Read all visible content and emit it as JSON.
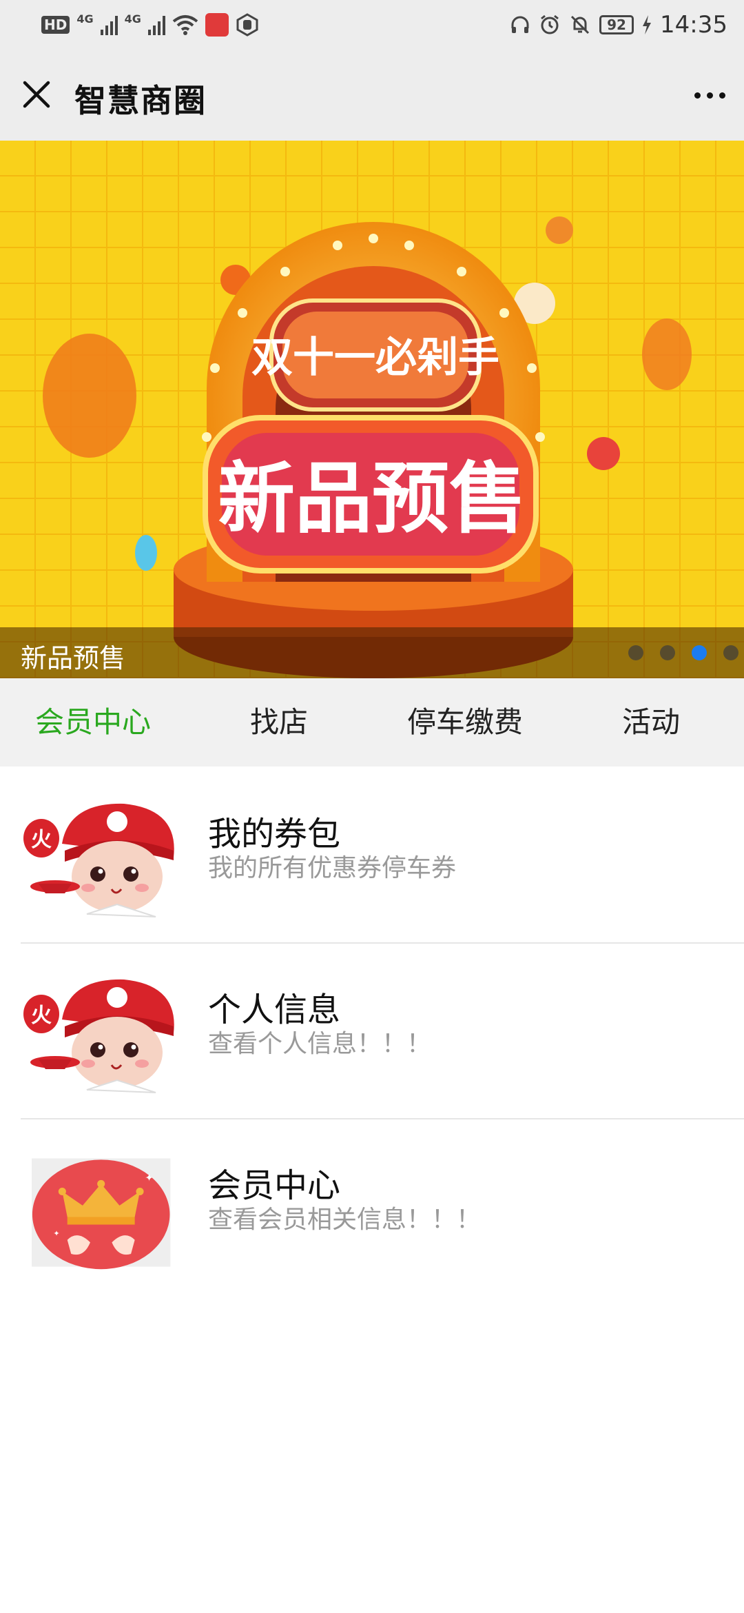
{
  "status_bar": {
    "left_label": "HD",
    "network_1": "4G",
    "network_2": "4G",
    "battery": "92",
    "time": "14:35"
  },
  "nav": {
    "title": "智慧商圈"
  },
  "banner": {
    "top_text": "双十一必剁手",
    "main_text": "新品预售",
    "caption": "新品预售",
    "slide_count": 4,
    "active_slide": 3
  },
  "tabs": [
    {
      "label": "会员中心",
      "active": true
    },
    {
      "label": "找店",
      "active": false
    },
    {
      "label": "停车缴费",
      "active": false
    },
    {
      "label": "活动",
      "active": false
    }
  ],
  "list": [
    {
      "title": "我的券包",
      "desc": "我的所有优惠券停车券",
      "icon": "chef-mascot-icon"
    },
    {
      "title": "个人信息",
      "desc": "查看个人信息！！！",
      "icon": "chef-mascot-icon"
    },
    {
      "title": "会员中心",
      "desc": "查看会员相关信息！！！",
      "icon": "crown-icon"
    }
  ],
  "colors": {
    "accent": "#2aa81f",
    "indicator": "#1b7cf0",
    "banner_bg": "#f7d117"
  }
}
